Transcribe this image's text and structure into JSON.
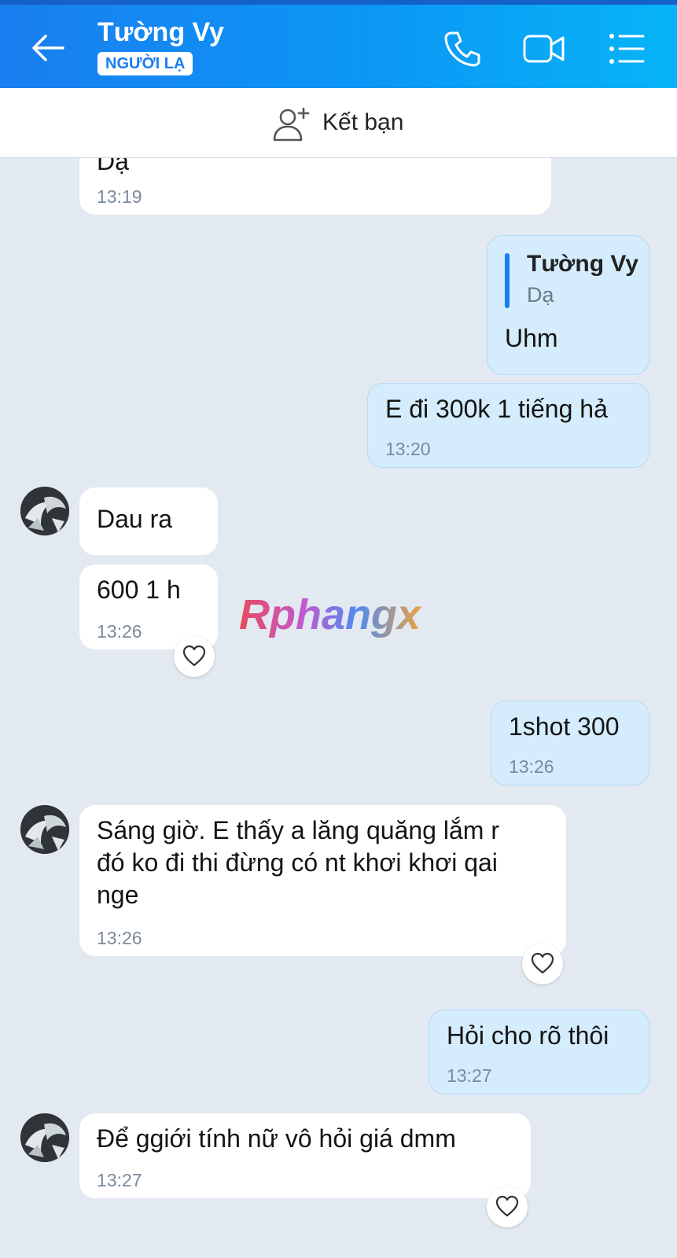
{
  "header": {
    "title": "Tường Vy",
    "badge": "NGƯỜI LẠ",
    "back_icon": "arrow-left-icon",
    "call_icon": "phone-icon",
    "video_icon": "video-camera-icon",
    "menu_icon": "list-menu-icon",
    "gradient_colors": [
      "#1a7ef0",
      "#07b4f7"
    ]
  },
  "add_friend": {
    "label": "Kết bạn",
    "icon": "add-person-icon"
  },
  "messages": [
    {
      "side": "in",
      "text": "Dạ",
      "time": "13:19"
    },
    {
      "side": "out",
      "quote_name": "Tường Vy",
      "quote_text": "Dạ",
      "text": "Uhm"
    },
    {
      "side": "out",
      "text": "E đi 300k 1 tiếng hả",
      "time": "13:20"
    },
    {
      "side": "in",
      "text": "Dau ra"
    },
    {
      "side": "in",
      "text": "600 1 h",
      "time": "13:26",
      "reaction": "heart-outline-icon"
    },
    {
      "side": "out",
      "text": "1shot 300",
      "time": "13:26"
    },
    {
      "side": "in",
      "lines": [
        "Sáng  giờ. E thấy a lăng quăng  lắm r",
        "đó ko đi thi đừng có nt khơi khơi qai",
        "nge"
      ],
      "time": "13:26",
      "reaction": "heart-outline-icon"
    },
    {
      "side": "out",
      "text": "Hỏi cho rõ thôi",
      "time": "13:27"
    },
    {
      "side": "in",
      "text": "Để ggiới tính  nữ vô hỏi  giá  dmm",
      "time": "13:27",
      "reaction": "heart-outline-icon"
    }
  ],
  "watermark": "Rphangx",
  "colors": {
    "incoming": "#ffffff",
    "outgoing": "#d4ecfc",
    "background": "#e2e9f1",
    "accent": "#1a7ef0"
  }
}
